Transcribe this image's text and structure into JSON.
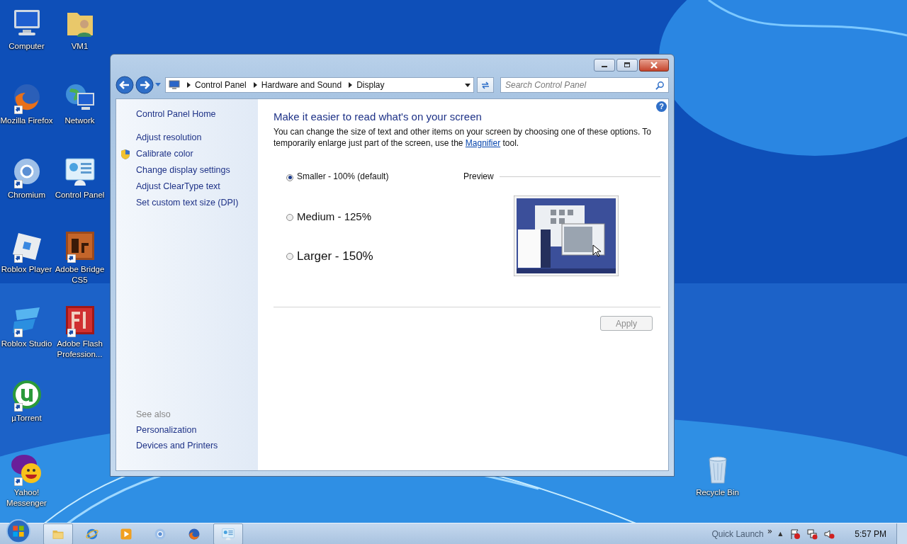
{
  "desktop": {
    "columns": [
      [
        {
          "label": "Computer",
          "kind": "computer",
          "shortcut": false
        },
        {
          "label": "Mozilla Firefox",
          "kind": "firefox",
          "shortcut": true
        },
        {
          "label": "Chromium",
          "kind": "chromium",
          "shortcut": true
        },
        {
          "label": "Roblox Player",
          "kind": "roblox",
          "shortcut": true
        },
        {
          "label": "Roblox Studio",
          "kind": "studio",
          "shortcut": true
        },
        {
          "label": "µTorrent",
          "kind": "utorrent",
          "shortcut": true
        },
        {
          "label": "Yahoo! Messenger",
          "kind": "yahoo",
          "shortcut": true
        }
      ],
      [
        {
          "label": "VM1",
          "kind": "user-folder",
          "shortcut": false
        },
        {
          "label": "Network",
          "kind": "network",
          "shortcut": false
        },
        {
          "label": "Control Panel",
          "kind": "control-panel",
          "shortcut": false
        },
        {
          "label": "Adobe Bridge CS5",
          "kind": "bridge",
          "shortcut": true
        },
        {
          "label": "Adobe Flash Profession...",
          "kind": "flash",
          "shortcut": true
        }
      ]
    ],
    "recycle_bin": {
      "label": "Recycle Bin"
    }
  },
  "window": {
    "address": {
      "breadcrumb": [
        "Control Panel",
        "Hardware and Sound",
        "Display"
      ]
    },
    "search": {
      "placeholder": "Search Control Panel"
    },
    "sidebar": {
      "home": "Control Panel Home",
      "links": [
        {
          "label": "Adjust resolution",
          "kind": "plain"
        },
        {
          "label": "Calibrate color",
          "kind": "shield"
        },
        {
          "label": "Change display settings",
          "kind": "plain"
        },
        {
          "label": "Adjust ClearType text",
          "kind": "plain"
        },
        {
          "label": "Set custom text size (DPI)",
          "kind": "plain"
        }
      ],
      "see_also": {
        "heading": "See also",
        "links": [
          "Personalization",
          "Devices and Printers"
        ]
      }
    },
    "help_button": "?",
    "title": "Make it easier to read what's on your screen",
    "description": {
      "before": "You can change the size of text and other items on your screen by choosing one of these options. To temporarily enlarge just part of the screen, use the",
      "link": "Magnifier",
      "after": "tool."
    },
    "options": [
      {
        "label": "Smaller - 100% (default)",
        "selected": true
      },
      {
        "label": "Medium - 125%",
        "selected": false
      },
      {
        "label": "Larger - 150%",
        "selected": false
      }
    ],
    "preview_label": "Preview",
    "apply_button": {
      "label": "Apply",
      "disabled": true
    }
  },
  "taskbar": {
    "items": [
      {
        "kind": "explorer",
        "running": true
      },
      {
        "kind": "ie",
        "running": false
      },
      {
        "kind": "media",
        "running": false
      },
      {
        "kind": "chromium",
        "running": false
      },
      {
        "kind": "firefox",
        "running": false
      },
      {
        "kind": "control-panel",
        "running": true
      }
    ],
    "quick_launch": "Quick Launch",
    "chevron": "»",
    "tray_arrow": "▲",
    "time": "5:57 PM"
  }
}
